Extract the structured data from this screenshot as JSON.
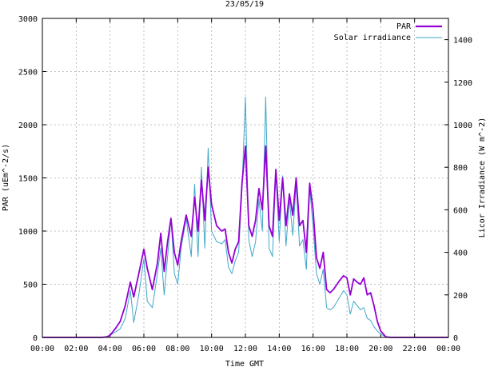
{
  "chart_data": {
    "type": "line",
    "title": "23/05/19",
    "xlabel": "Time GMT",
    "ylabel": "PAR (uEm^-2/s)",
    "y2label": "Licor Irradiance (W m^-2)",
    "xlim": [
      0,
      24
    ],
    "ylim": [
      0,
      3000
    ],
    "y2lim": [
      0,
      1500
    ],
    "grid": true,
    "legend_position": "top-right",
    "x_tick_labels": [
      "00:00",
      "02:00",
      "04:00",
      "06:00",
      "08:00",
      "10:00",
      "12:00",
      "14:00",
      "16:00",
      "18:00",
      "20:00",
      "22:00",
      "00:00"
    ],
    "y_tick_labels": [
      "0",
      "500",
      "1000",
      "1500",
      "2000",
      "2500",
      "3000"
    ],
    "y2_tick_labels": [
      "0",
      "200",
      "400",
      "600",
      "800",
      "1000",
      "1200",
      "1400"
    ],
    "series": [
      {
        "name": "PAR",
        "axis": "left",
        "color": "#9400d3",
        "points": [
          [
            0,
            0
          ],
          [
            3.5,
            0
          ],
          [
            3.8,
            5
          ],
          [
            4.0,
            20
          ],
          [
            4.3,
            80
          ],
          [
            4.6,
            150
          ],
          [
            4.9,
            300
          ],
          [
            5.2,
            520
          ],
          [
            5.4,
            380
          ],
          [
            5.7,
            600
          ],
          [
            6.0,
            830
          ],
          [
            6.2,
            650
          ],
          [
            6.5,
            450
          ],
          [
            6.8,
            700
          ],
          [
            7.0,
            980
          ],
          [
            7.2,
            620
          ],
          [
            7.4,
            900
          ],
          [
            7.6,
            1120
          ],
          [
            7.8,
            800
          ],
          [
            8.0,
            680
          ],
          [
            8.2,
            900
          ],
          [
            8.5,
            1150
          ],
          [
            8.8,
            950
          ],
          [
            9.0,
            1320
          ],
          [
            9.2,
            1000
          ],
          [
            9.4,
            1480
          ],
          [
            9.6,
            1100
          ],
          [
            9.8,
            1600
          ],
          [
            10.0,
            1250
          ],
          [
            10.3,
            1050
          ],
          [
            10.6,
            1000
          ],
          [
            10.8,
            1020
          ],
          [
            11.0,
            800
          ],
          [
            11.2,
            700
          ],
          [
            11.4,
            830
          ],
          [
            11.6,
            900
          ],
          [
            11.8,
            1450
          ],
          [
            12.0,
            1800
          ],
          [
            12.2,
            1050
          ],
          [
            12.4,
            950
          ],
          [
            12.6,
            1100
          ],
          [
            12.8,
            1400
          ],
          [
            13.0,
            1200
          ],
          [
            13.2,
            1800
          ],
          [
            13.4,
            1050
          ],
          [
            13.6,
            950
          ],
          [
            13.8,
            1580
          ],
          [
            14.0,
            1100
          ],
          [
            14.2,
            1500
          ],
          [
            14.4,
            1050
          ],
          [
            14.6,
            1350
          ],
          [
            14.8,
            1150
          ],
          [
            15.0,
            1500
          ],
          [
            15.2,
            1050
          ],
          [
            15.4,
            1100
          ],
          [
            15.6,
            800
          ],
          [
            15.8,
            1450
          ],
          [
            16.0,
            1200
          ],
          [
            16.2,
            750
          ],
          [
            16.4,
            650
          ],
          [
            16.6,
            800
          ],
          [
            16.8,
            450
          ],
          [
            17.0,
            420
          ],
          [
            17.2,
            450
          ],
          [
            17.5,
            520
          ],
          [
            17.8,
            580
          ],
          [
            18.0,
            560
          ],
          [
            18.2,
            400
          ],
          [
            18.4,
            550
          ],
          [
            18.6,
            520
          ],
          [
            18.8,
            500
          ],
          [
            19.0,
            560
          ],
          [
            19.2,
            400
          ],
          [
            19.4,
            420
          ],
          [
            19.6,
            300
          ],
          [
            19.8,
            150
          ],
          [
            20.0,
            60
          ],
          [
            20.3,
            5
          ],
          [
            20.6,
            0
          ],
          [
            24,
            0
          ]
        ]
      },
      {
        "name": "Solar irradiance",
        "axis": "right",
        "color": "#41a7c8",
        "points": [
          [
            0,
            0
          ],
          [
            3.5,
            0
          ],
          [
            3.8,
            2
          ],
          [
            4.0,
            10
          ],
          [
            4.3,
            25
          ],
          [
            4.6,
            40
          ],
          [
            4.9,
            90
          ],
          [
            5.2,
            220
          ],
          [
            5.4,
            70
          ],
          [
            5.7,
            200
          ],
          [
            6.0,
            370
          ],
          [
            6.2,
            170
          ],
          [
            6.5,
            140
          ],
          [
            6.8,
            300
          ],
          [
            7.0,
            420
          ],
          [
            7.2,
            200
          ],
          [
            7.4,
            380
          ],
          [
            7.6,
            560
          ],
          [
            7.8,
            300
          ],
          [
            8.0,
            250
          ],
          [
            8.2,
            420
          ],
          [
            8.5,
            560
          ],
          [
            8.8,
            380
          ],
          [
            9.0,
            720
          ],
          [
            9.2,
            380
          ],
          [
            9.4,
            800
          ],
          [
            9.6,
            420
          ],
          [
            9.8,
            890
          ],
          [
            10.0,
            500
          ],
          [
            10.3,
            450
          ],
          [
            10.6,
            440
          ],
          [
            10.8,
            460
          ],
          [
            11.0,
            330
          ],
          [
            11.2,
            300
          ],
          [
            11.4,
            360
          ],
          [
            11.6,
            400
          ],
          [
            11.8,
            700
          ],
          [
            12.0,
            1130
          ],
          [
            12.2,
            460
          ],
          [
            12.4,
            380
          ],
          [
            12.6,
            450
          ],
          [
            12.8,
            650
          ],
          [
            13.0,
            500
          ],
          [
            13.2,
            1130
          ],
          [
            13.4,
            420
          ],
          [
            13.6,
            380
          ],
          [
            13.8,
            780
          ],
          [
            14.0,
            450
          ],
          [
            14.2,
            760
          ],
          [
            14.4,
            430
          ],
          [
            14.6,
            650
          ],
          [
            14.8,
            480
          ],
          [
            15.0,
            720
          ],
          [
            15.2,
            430
          ],
          [
            15.4,
            460
          ],
          [
            15.6,
            320
          ],
          [
            15.8,
            700
          ],
          [
            16.0,
            520
          ],
          [
            16.2,
            300
          ],
          [
            16.4,
            250
          ],
          [
            16.6,
            320
          ],
          [
            16.8,
            140
          ],
          [
            17.0,
            130
          ],
          [
            17.2,
            140
          ],
          [
            17.5,
            180
          ],
          [
            17.8,
            220
          ],
          [
            18.0,
            200
          ],
          [
            18.2,
            110
          ],
          [
            18.4,
            170
          ],
          [
            18.6,
            150
          ],
          [
            18.8,
            130
          ],
          [
            19.0,
            140
          ],
          [
            19.2,
            90
          ],
          [
            19.4,
            80
          ],
          [
            19.6,
            50
          ],
          [
            19.8,
            30
          ],
          [
            20.0,
            15
          ],
          [
            20.3,
            3
          ],
          [
            20.6,
            0
          ],
          [
            24,
            0
          ]
        ]
      }
    ]
  }
}
